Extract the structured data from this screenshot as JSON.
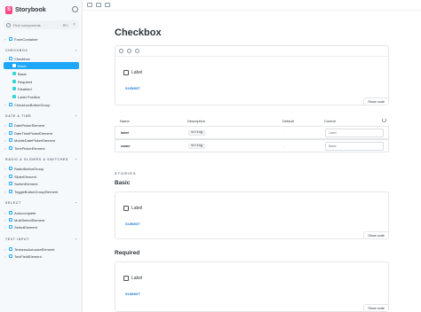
{
  "sidebar": {
    "brand": "Storybook",
    "search_placeholder": "Find components",
    "search_shortcut": "⌘K",
    "clear_glyph": "×",
    "items": [
      {
        "label": "FormContainer"
      },
      {
        "label": "Checkbox"
      },
      {
        "label": "Basic"
      },
      {
        "label": "Basic"
      },
      {
        "label": "Required"
      },
      {
        "label": "Disabled"
      },
      {
        "label": "Label Position"
      },
      {
        "label": "CheckboxButtonGroup"
      },
      {
        "label": "DatePickerElement"
      },
      {
        "label": "DateTimePickerElement"
      },
      {
        "label": "MobileDatePickerElement"
      },
      {
        "label": "TimePickerElement"
      },
      {
        "label": "RadioButtonGroup"
      },
      {
        "label": "SliderElement"
      },
      {
        "label": "SwitchElement"
      },
      {
        "label": "ToggleButtonGroupElement"
      },
      {
        "label": "Autocomplete"
      },
      {
        "label": "MultiSelectElement"
      },
      {
        "label": "SelectElement"
      },
      {
        "label": "TextareaAutosizeElement"
      },
      {
        "label": "TextFieldElement"
      }
    ],
    "groups": [
      {
        "label": "CHECKBOX"
      },
      {
        "label": "DATE & TIME"
      },
      {
        "label": "RADIO & SLIDERS & SWITCHES"
      },
      {
        "label": "SELECT"
      },
      {
        "label": "TEXT INPUT"
      }
    ]
  },
  "main": {
    "title": "Checkbox",
    "preview": {
      "checkbox_label": "Label",
      "submit_label": "SUBMIT",
      "show_code": "Show code"
    },
    "args_table": {
      "headers": [
        "Name",
        "Description",
        "Default",
        "Control"
      ],
      "rows": [
        {
          "name": "label",
          "type": "string",
          "default": "-",
          "control_placeholder": "Label"
        },
        {
          "name": "name",
          "type": "string",
          "default": "-",
          "control_placeholder": "Basic"
        }
      ]
    },
    "stories_label": "STORIES",
    "stories": [
      {
        "title": "Basic",
        "checkbox_label": "Label",
        "submit_label": "SUBMIT",
        "show_code": "Show code"
      },
      {
        "title": "Required",
        "checkbox_label": "Label",
        "submit_label": "SUBMIT",
        "show_code": "Show code"
      }
    ]
  },
  "colors": {
    "accent": "#1ea7fd",
    "brand": "#ff4785",
    "submit": "#1976d2"
  }
}
